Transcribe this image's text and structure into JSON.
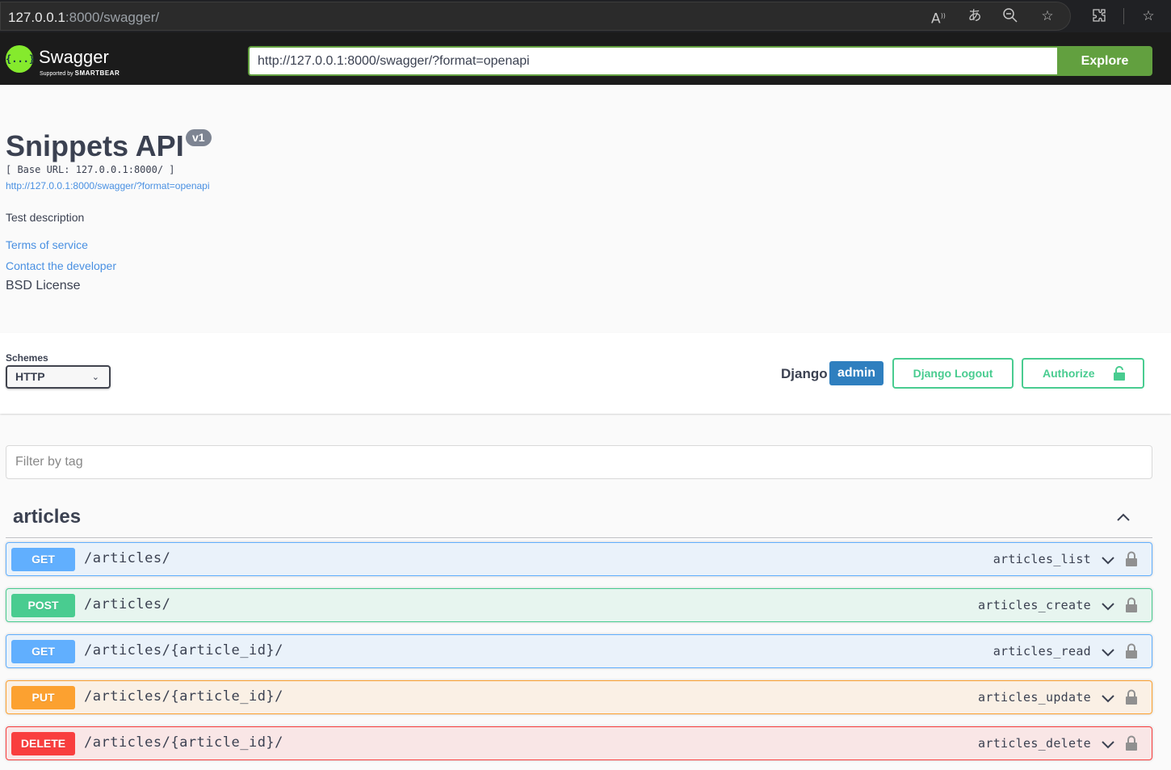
{
  "browser": {
    "url_host": "127.0.0.1",
    "url_rest": ":8000/swagger/",
    "icons": [
      "read-aloud-icon",
      "translate-icon",
      "zoom-out-icon",
      "add-favorite-icon",
      "extensions-icon",
      "favorites-icon"
    ]
  },
  "topbar": {
    "logo_name": "Swagger",
    "logo_symbol": "{...}",
    "logo_supported": "Supported by",
    "logo_brand": "SMARTBEAR",
    "spec_url": "http://127.0.0.1:8000/swagger/?format=openapi",
    "explore_label": "Explore"
  },
  "info": {
    "title": "Snippets API",
    "version": "v1",
    "base_url": "[ Base URL: 127.0.0.1:8000/ ]",
    "spec_link": "http://127.0.0.1:8000/swagger/?format=openapi",
    "description": "Test description",
    "terms": "Terms of service",
    "contact": "Contact the developer",
    "license": "BSD License"
  },
  "schemes": {
    "label": "Schemes",
    "selected": "HTTP"
  },
  "auth": {
    "django_label": "Django",
    "username": "admin",
    "logout_label": "Django Logout",
    "authorize_label": "Authorize"
  },
  "filter": {
    "placeholder": "Filter by tag"
  },
  "tag": {
    "name": "articles",
    "operations": [
      {
        "method": "GET",
        "path": "/articles/",
        "operation_id": "articles_list"
      },
      {
        "method": "POST",
        "path": "/articles/",
        "operation_id": "articles_create"
      },
      {
        "method": "GET",
        "path": "/articles/{article_id}/",
        "operation_id": "articles_read"
      },
      {
        "method": "PUT",
        "path": "/articles/{article_id}/",
        "operation_id": "articles_update"
      },
      {
        "method": "DELETE",
        "path": "/articles/{article_id}/",
        "operation_id": "articles_delete"
      }
    ]
  },
  "colors": {
    "get": "#61affe",
    "post": "#49cc90",
    "put": "#fca130",
    "delete": "#f93e3e",
    "explore": "#62a03f",
    "user_badge": "#2f7fbf"
  }
}
